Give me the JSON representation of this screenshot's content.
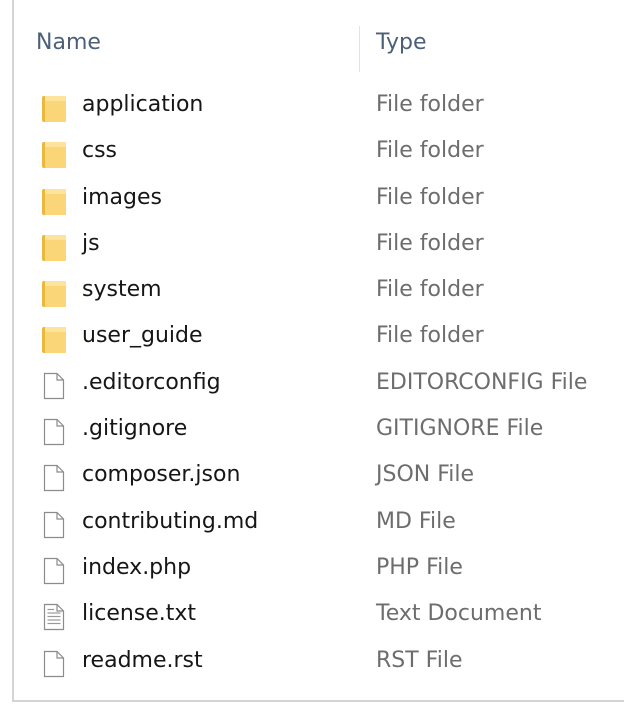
{
  "columns": {
    "name": "Name",
    "type": "Type"
  },
  "items": [
    {
      "name": "application",
      "type": "File folder",
      "icon": "folder-icon"
    },
    {
      "name": "css",
      "type": "File folder",
      "icon": "folder-icon"
    },
    {
      "name": "images",
      "type": "File folder",
      "icon": "folder-icon"
    },
    {
      "name": "js",
      "type": "File folder",
      "icon": "folder-icon"
    },
    {
      "name": "system",
      "type": "File folder",
      "icon": "folder-icon"
    },
    {
      "name": "user_guide",
      "type": "File folder",
      "icon": "folder-icon"
    },
    {
      "name": ".editorconfig",
      "type": "EDITORCONFIG File",
      "icon": "file-icon"
    },
    {
      "name": ".gitignore",
      "type": "GITIGNORE File",
      "icon": "file-icon"
    },
    {
      "name": "composer.json",
      "type": "JSON File",
      "icon": "file-icon"
    },
    {
      "name": "contributing.md",
      "type": "MD File",
      "icon": "file-icon"
    },
    {
      "name": "index.php",
      "type": "PHP File",
      "icon": "file-icon"
    },
    {
      "name": "license.txt",
      "type": "Text Document",
      "icon": "text-document-icon"
    },
    {
      "name": "readme.rst",
      "type": "RST File",
      "icon": "file-icon"
    }
  ],
  "colors": {
    "header_text": "#4c607a",
    "type_text": "#6d6d6d",
    "folder_front": "#fbd678",
    "folder_back": "#e9b93e"
  }
}
